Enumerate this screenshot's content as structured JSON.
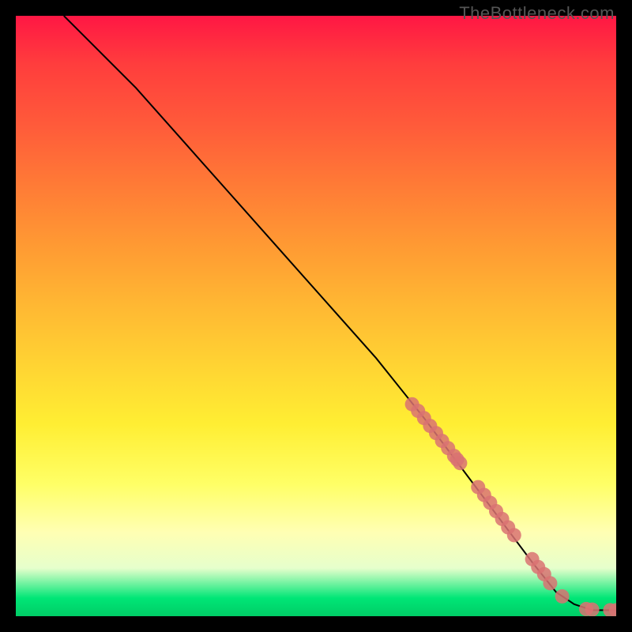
{
  "attribution": "TheBottleneck.com",
  "colors": {
    "marker": "#d97272",
    "curve": "#000000"
  },
  "chart_data": {
    "type": "line",
    "title": "",
    "xlabel": "",
    "ylabel": "",
    "xlim": [
      0,
      100
    ],
    "ylim": [
      0,
      100
    ],
    "grid": false,
    "curve": {
      "x": [
        8,
        10,
        14,
        20,
        28,
        36,
        44,
        52,
        60,
        68,
        74,
        80,
        86,
        90,
        93,
        96,
        100
      ],
      "y": [
        100,
        98,
        94,
        88,
        79,
        70,
        61,
        52,
        43,
        33,
        25,
        17,
        9,
        4,
        2,
        1,
        1
      ]
    },
    "markers": {
      "x": [
        66,
        67,
        68,
        69,
        70,
        71,
        72,
        73,
        73.5,
        74,
        77,
        78,
        79,
        80,
        81,
        82,
        83,
        86,
        87,
        88,
        89,
        91,
        95,
        96,
        99,
        100
      ],
      "y": [
        35.3,
        34.2,
        33.0,
        31.7,
        30.5,
        29.2,
        28.0,
        26.7,
        26.1,
        25.5,
        21.5,
        20.2,
        18.9,
        17.5,
        16.2,
        14.8,
        13.5,
        9.5,
        8.2,
        7.0,
        5.5,
        3.3,
        1.2,
        1.1,
        1.0,
        1.0
      ]
    }
  }
}
